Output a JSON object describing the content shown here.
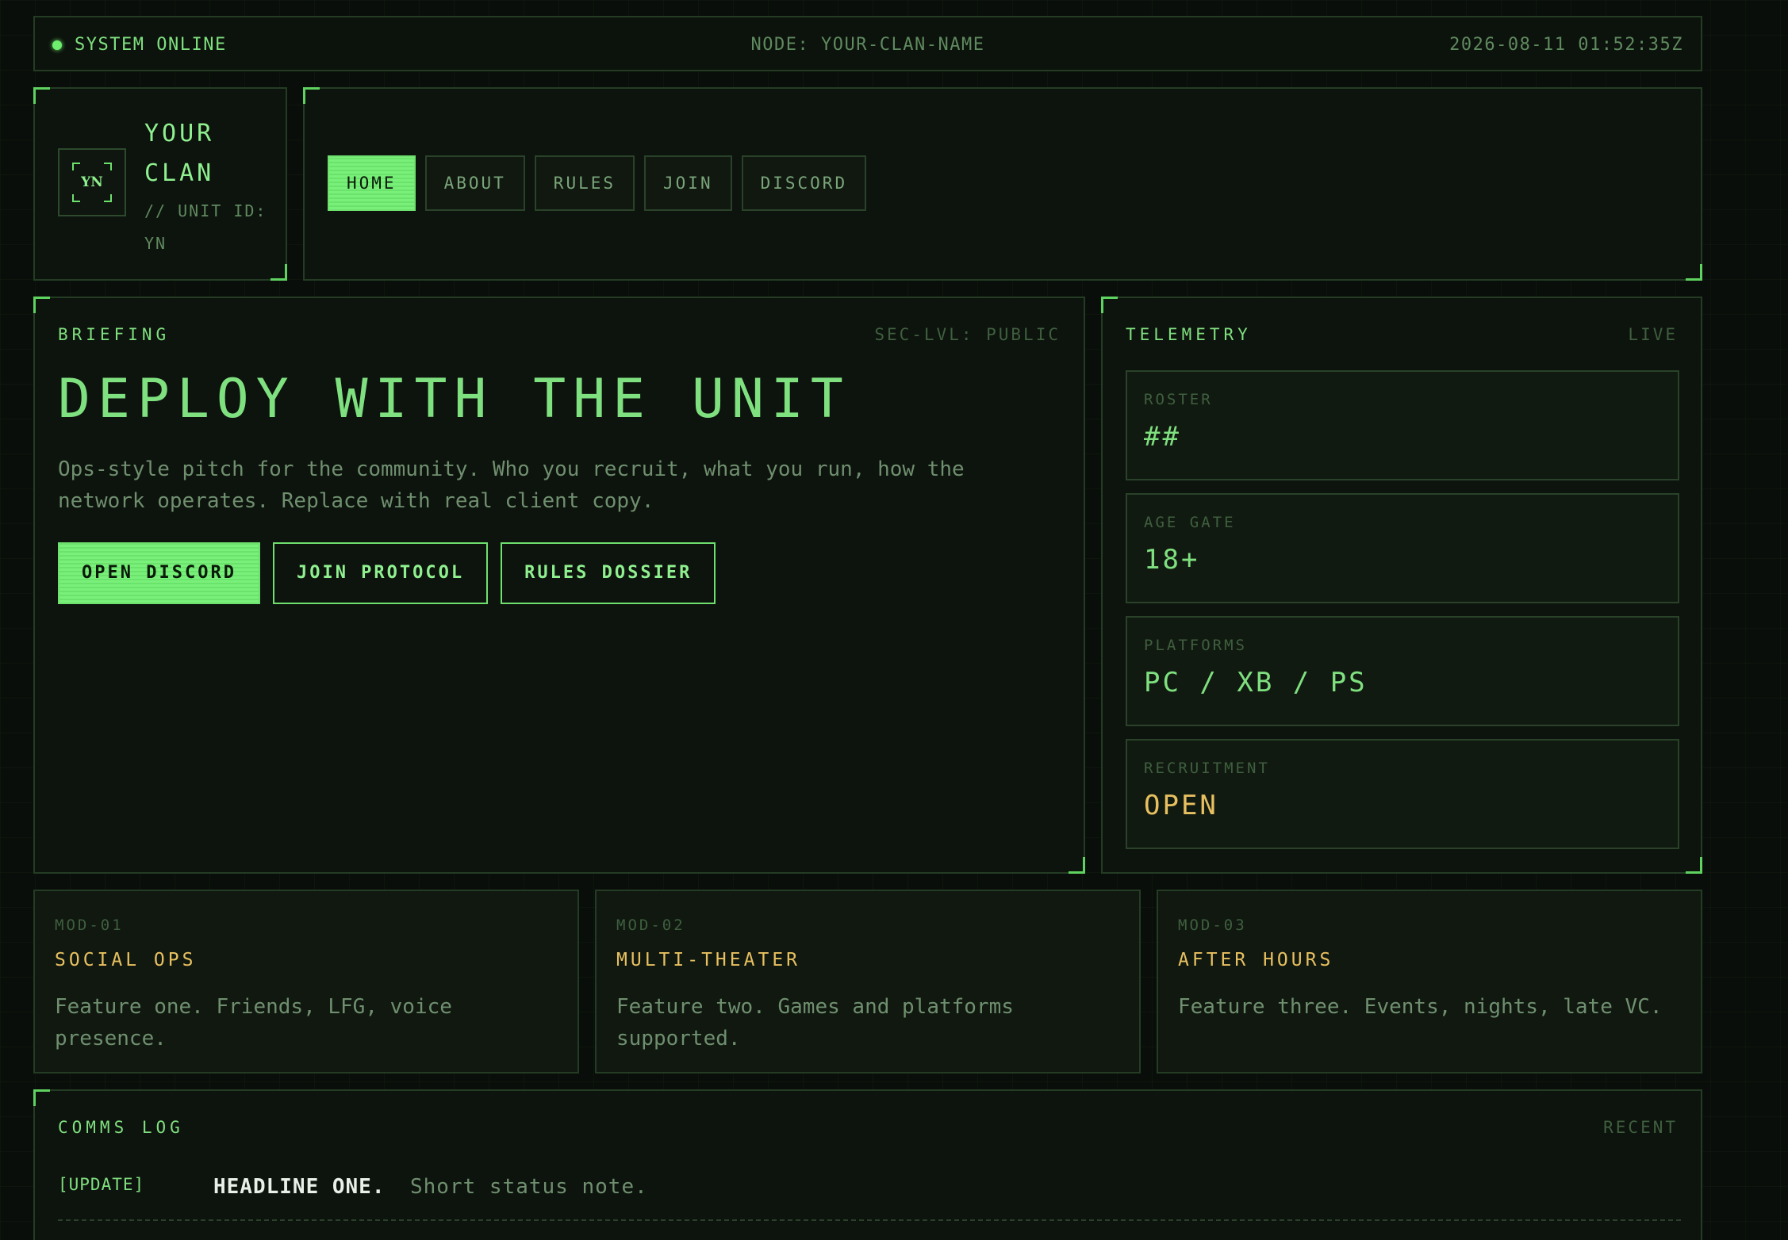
{
  "status": {
    "system": "SYSTEM ONLINE",
    "node": "NODE: YOUR-CLAN-NAME",
    "timestamp": "2026-08-11 01:52:35Z"
  },
  "brand": {
    "logo_text": "YN",
    "name": "YOUR CLAN",
    "sub": "// UNIT ID: YN"
  },
  "nav": {
    "items": [
      {
        "label": "HOME",
        "active": true
      },
      {
        "label": "ABOUT",
        "active": false
      },
      {
        "label": "RULES",
        "active": false
      },
      {
        "label": "JOIN",
        "active": false
      },
      {
        "label": "DISCORD",
        "active": false
      }
    ]
  },
  "briefing": {
    "label": "BRIEFING",
    "meta": "SEC-LVL: PUBLIC",
    "headline": "DEPLOY WITH THE UNIT",
    "pitch": "Ops-style pitch for the community. Who you recruit, what you run, how the network operates. Replace with real client copy.",
    "buttons": {
      "primary": "OPEN DISCORD",
      "join": "JOIN PROTOCOL",
      "rules": "RULES DOSSIER"
    }
  },
  "telemetry": {
    "label": "TELEMETRY",
    "meta": "LIVE",
    "stats": [
      {
        "label": "ROSTER",
        "value": "##"
      },
      {
        "label": "AGE GATE",
        "value": "18+"
      },
      {
        "label": "PLATFORMS",
        "value": "PC / XB / PS"
      },
      {
        "label": "RECRUITMENT",
        "value": "OPEN"
      }
    ]
  },
  "modules": [
    {
      "id": "MOD-01",
      "title": "SOCIAL OPS",
      "text": "Feature one. Friends, LFG, voice presence."
    },
    {
      "id": "MOD-02",
      "title": "MULTI-THEATER",
      "text": "Feature two. Games and platforms supported."
    },
    {
      "id": "MOD-03",
      "title": "AFTER HOURS",
      "text": "Feature three. Events, nights, late VC."
    }
  ],
  "comms": {
    "label": "COMMS LOG",
    "meta": "RECENT",
    "entries": [
      {
        "tag": "[UPDATE]",
        "headline": "HEADLINE ONE.",
        "note": "Short status note."
      }
    ]
  },
  "colors": {
    "accent": "#7fe07f",
    "amber": "#e8c060",
    "background": "#0a0e0a",
    "border": "#243c24"
  }
}
